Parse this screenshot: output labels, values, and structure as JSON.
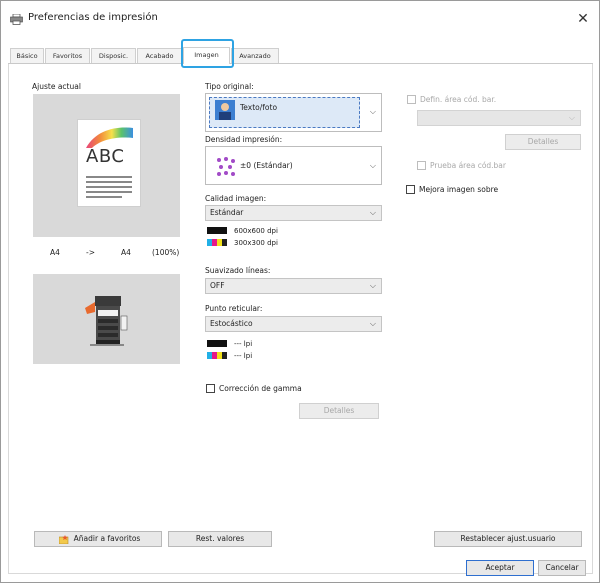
{
  "window": {
    "title": "Preferencias de impresión",
    "close_glyph": "✕"
  },
  "tabs": [
    {
      "label": "Básico"
    },
    {
      "label": "Favoritos"
    },
    {
      "label": "Disposic."
    },
    {
      "label": "Acabado"
    },
    {
      "label": "Imagen",
      "active": true
    },
    {
      "label": "Avanzado"
    }
  ],
  "left": {
    "current_setting_label": "Ajuste actual",
    "preview_text": "ABC",
    "size_from": "A4",
    "arrow": "->",
    "size_to": "A4",
    "scale": "(100%)"
  },
  "middle": {
    "original_type": {
      "label": "Tipo original:",
      "value": "Texto/foto"
    },
    "print_density": {
      "label": "Densidad impresión:",
      "value": "±0 (Estándar)"
    },
    "image_quality": {
      "label": "Calidad imagen:",
      "value": "Estándar",
      "res1": "600x600 dpi",
      "res2": "300x300 dpi"
    },
    "line_smoothing": {
      "label": "Suavizado líneas:",
      "value": "OFF"
    },
    "screening": {
      "label": "Punto reticular:",
      "value": "Estocástico",
      "lpi1": "--- lpi",
      "lpi2": "--- lpi"
    },
    "gamma": {
      "label": "Corrección de gamma",
      "details": "Detalles"
    }
  },
  "right": {
    "barcode_area": {
      "label": "Defin. área cód. bar.",
      "details": "Detalles"
    },
    "barcode_test": {
      "label": "Prueba área cód.bar"
    },
    "image_enhance": {
      "label": "Mejora imagen sobre"
    }
  },
  "bottom": {
    "add_favorites": "Añadir a favoritos",
    "reset_values": "Rest. valores",
    "restore_user": "Restablecer ajust.usuario",
    "ok": "Aceptar",
    "cancel": "Cancelar"
  },
  "colors": {
    "accent_highlight": "#2ea3e3",
    "selected_fill": "#dde9f7",
    "panel_gray": "#d9d9d9"
  },
  "icons": [
    "printer-icon",
    "close-icon",
    "chevron-down-icon",
    "text-photo-icon",
    "density-dots-icon",
    "printer-device-icon",
    "star-folder-icon"
  ]
}
